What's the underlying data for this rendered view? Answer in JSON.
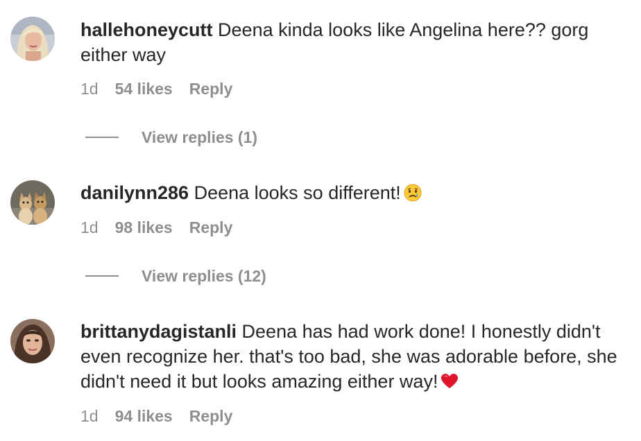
{
  "comments": [
    {
      "username": "hallehoneycutt",
      "text": "Deena kinda looks like Angelina here?? gorg either way",
      "time": "1d",
      "likes": "54 likes",
      "reply": "Reply",
      "view_replies": "View replies (1)",
      "avatar_icon": "avatar-blonde-woman"
    },
    {
      "username": "danilynn286",
      "text": "Deena looks so different!",
      "emoji_icon": "crying-face-icon",
      "time": "1d",
      "likes": "98 likes",
      "reply": "Reply",
      "view_replies": "View replies (12)",
      "avatar_icon": "avatar-two-dogs"
    },
    {
      "username": "brittanydagistanli",
      "text": "Deena has had work done! I honestly didn't even recognize her. that's too bad, she was adorable before, she didn't need it but looks amazing either way!",
      "emoji_icon": "red-heart-icon",
      "time": "1d",
      "likes": "94 likes",
      "reply": "Reply",
      "avatar_icon": "avatar-brunette-woman"
    }
  ],
  "colors": {
    "text_primary": "#262626",
    "text_secondary": "#8e8e8e"
  }
}
